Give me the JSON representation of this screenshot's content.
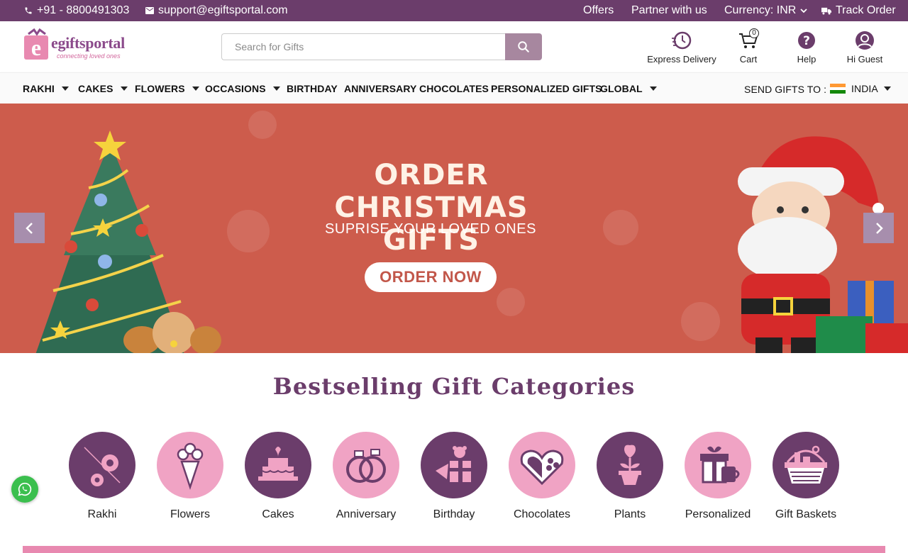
{
  "topbar": {
    "phone": "+91 - 8800491303",
    "email": "support@egiftsportal.com",
    "offers": "Offers",
    "partner": "Partner with us",
    "currency": "Currency: INR",
    "track": "Track Order"
  },
  "header": {
    "logo_brand": "egiftsportal",
    "logo_tagline": "connecting loved ones",
    "search_placeholder": "Search for Gifts",
    "express_delivery": "Express Delivery",
    "cart": "Cart",
    "cart_count": "0",
    "help": "Help",
    "account": "Hi Guest"
  },
  "nav": {
    "items": [
      "RAKHI",
      "CAKES",
      "FLOWERS",
      "OCCASIONS",
      "BIRTHDAY",
      "ANNIVERSARY",
      "CHOCOLATES",
      "PERSONALIZED GIFTS",
      "GLOBAL"
    ],
    "send_to_label": "SEND GIFTS TO :",
    "country": "INDIA"
  },
  "hero": {
    "title": "ORDER CHRISTMAS GIFTS",
    "subtitle": "SUPRISE YOUR LOVED ONES",
    "cta": "ORDER NOW"
  },
  "categories": {
    "title": "Bestselling  Gift Categories",
    "items": [
      "Rakhi",
      "Flowers",
      "Cakes",
      "Anniversary",
      "Birthday",
      "Chocolates",
      "Plants",
      "Personalized",
      "Gift Baskets"
    ]
  },
  "colors": {
    "brand_purple": "#6b3d6b",
    "pink": "#f0a3c4",
    "hero_red": "#cd5c4c",
    "search_button": "#a7879f",
    "whatsapp": "#3bbf4e"
  }
}
